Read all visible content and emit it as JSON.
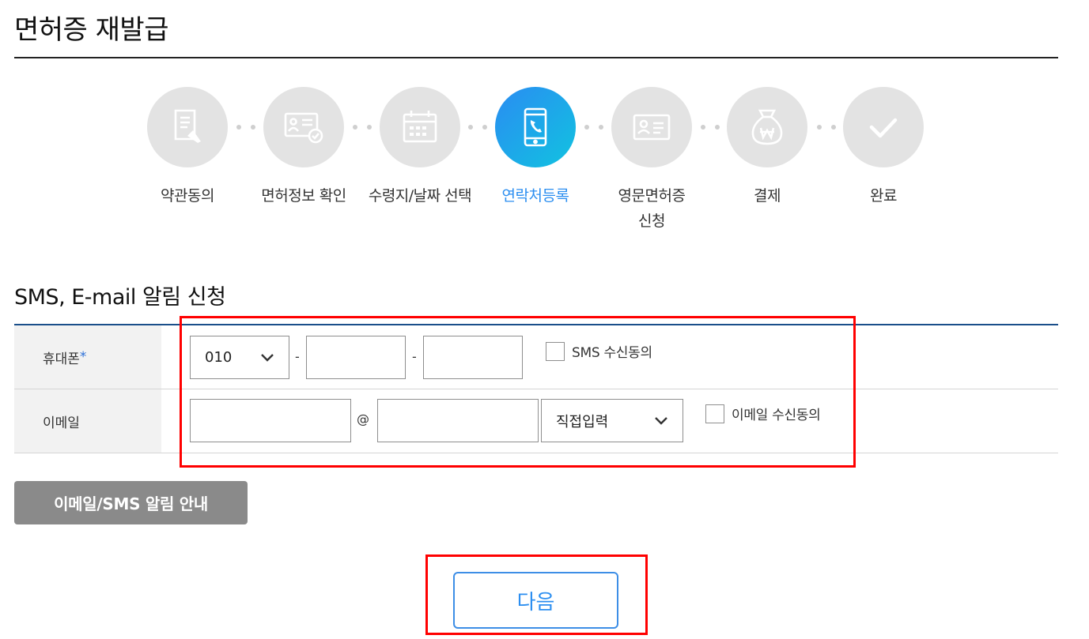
{
  "page": {
    "title": "면허증 재발급"
  },
  "steps": [
    {
      "label": "약관동의",
      "icon": "document-sign-icon",
      "active": false
    },
    {
      "label": "면허정보 확인",
      "icon": "license-check-icon",
      "active": false
    },
    {
      "label": "수령지/날짜 선택",
      "icon": "calendar-icon",
      "active": false
    },
    {
      "label": "연락처등록",
      "icon": "phone-icon",
      "active": true
    },
    {
      "label": "영문면허증\n신청",
      "icon": "id-card-icon",
      "active": false
    },
    {
      "label": "결제",
      "icon": "won-bag-icon",
      "active": false
    },
    {
      "label": "완료",
      "icon": "check-icon",
      "active": false
    }
  ],
  "section": {
    "title": "SMS, E-mail 알림 신청"
  },
  "form": {
    "phone": {
      "label": "휴대폰",
      "required_mark": "*",
      "prefix_value": "010",
      "separator": "-",
      "sms_consent_label": "SMS 수신동의"
    },
    "email": {
      "label": "이메일",
      "at": "@",
      "domain_select_value": "직접입력",
      "email_consent_label": "이메일 수신동의"
    }
  },
  "buttons": {
    "notice": "이메일/SMS 알림 안내",
    "next": "다음"
  },
  "colors": {
    "active_step": "#2b8ef0",
    "inactive_step_bg": "#e3e3e3",
    "highlight": "#ff0000",
    "table_top_border": "#1a4f8a"
  }
}
